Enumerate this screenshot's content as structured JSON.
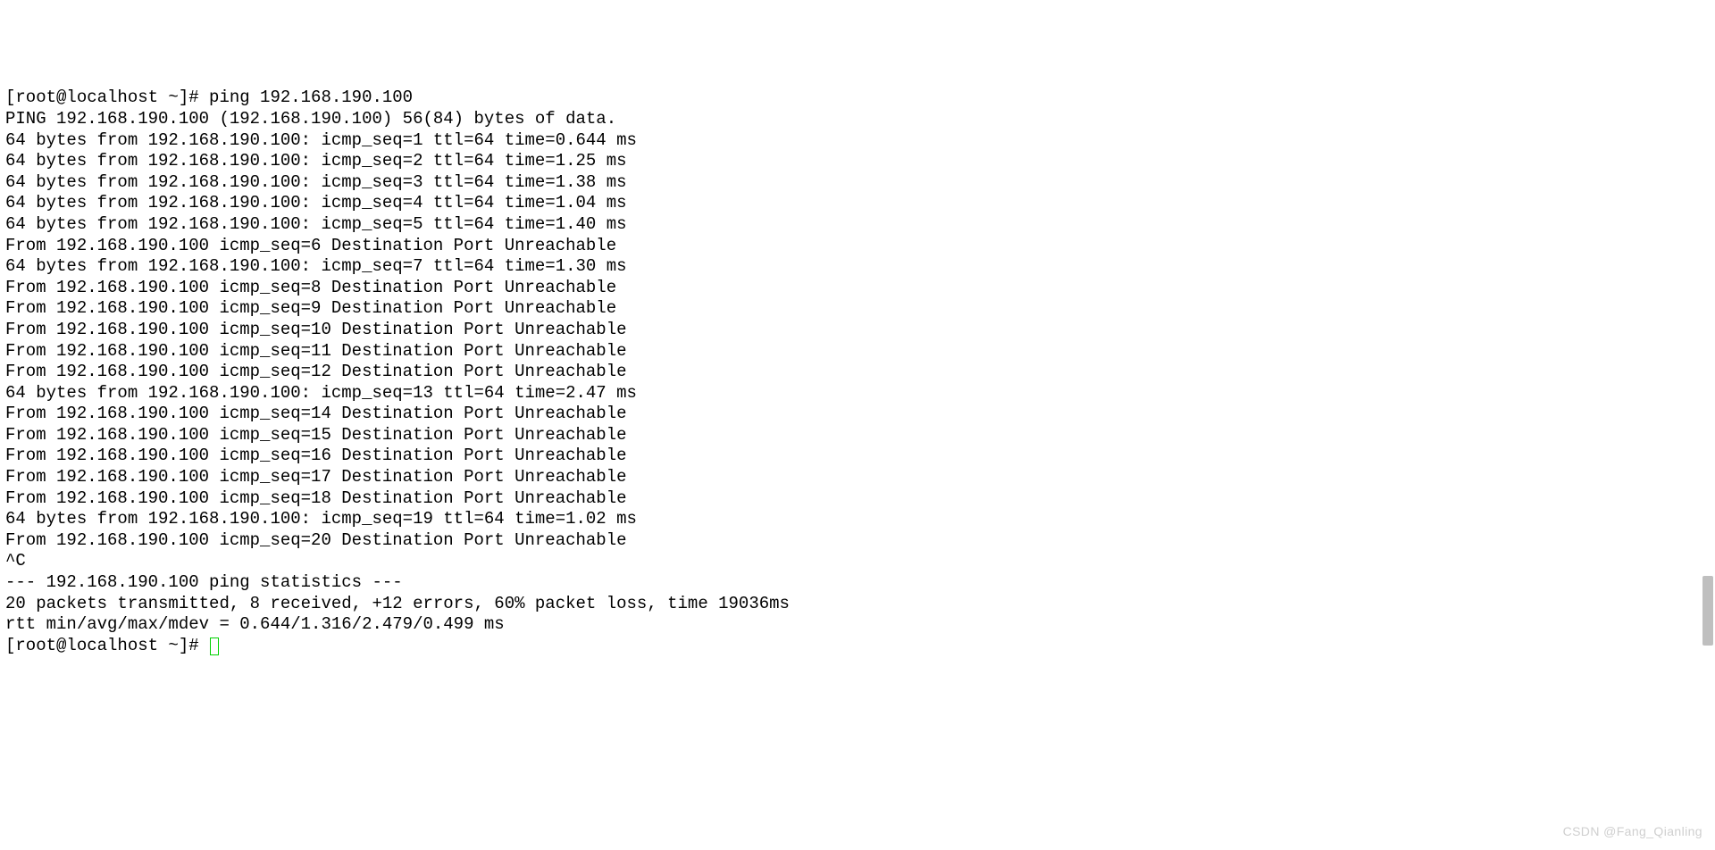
{
  "lines": [
    "[root@localhost ~]# ping 192.168.190.100",
    "PING 192.168.190.100 (192.168.190.100) 56(84) bytes of data.",
    "64 bytes from 192.168.190.100: icmp_seq=1 ttl=64 time=0.644 ms",
    "64 bytes from 192.168.190.100: icmp_seq=2 ttl=64 time=1.25 ms",
    "64 bytes from 192.168.190.100: icmp_seq=3 ttl=64 time=1.38 ms",
    "64 bytes from 192.168.190.100: icmp_seq=4 ttl=64 time=1.04 ms",
    "64 bytes from 192.168.190.100: icmp_seq=5 ttl=64 time=1.40 ms",
    "From 192.168.190.100 icmp_seq=6 Destination Port Unreachable",
    "64 bytes from 192.168.190.100: icmp_seq=7 ttl=64 time=1.30 ms",
    "From 192.168.190.100 icmp_seq=8 Destination Port Unreachable",
    "From 192.168.190.100 icmp_seq=9 Destination Port Unreachable",
    "From 192.168.190.100 icmp_seq=10 Destination Port Unreachable",
    "From 192.168.190.100 icmp_seq=11 Destination Port Unreachable",
    "From 192.168.190.100 icmp_seq=12 Destination Port Unreachable",
    "64 bytes from 192.168.190.100: icmp_seq=13 ttl=64 time=2.47 ms",
    "From 192.168.190.100 icmp_seq=14 Destination Port Unreachable",
    "From 192.168.190.100 icmp_seq=15 Destination Port Unreachable",
    "From 192.168.190.100 icmp_seq=16 Destination Port Unreachable",
    "From 192.168.190.100 icmp_seq=17 Destination Port Unreachable",
    "From 192.168.190.100 icmp_seq=18 Destination Port Unreachable",
    "64 bytes from 192.168.190.100: icmp_seq=19 ttl=64 time=1.02 ms",
    "From 192.168.190.100 icmp_seq=20 Destination Port Unreachable",
    "^C",
    "--- 192.168.190.100 ping statistics ---",
    "20 packets transmitted, 8 received, +12 errors, 60% packet loss, time 19036ms",
    "rtt min/avg/max/mdev = 0.644/1.316/2.479/0.499 ms"
  ],
  "prompt": "[root@localhost ~]# ",
  "watermark": "CSDN @Fang_Qianling"
}
